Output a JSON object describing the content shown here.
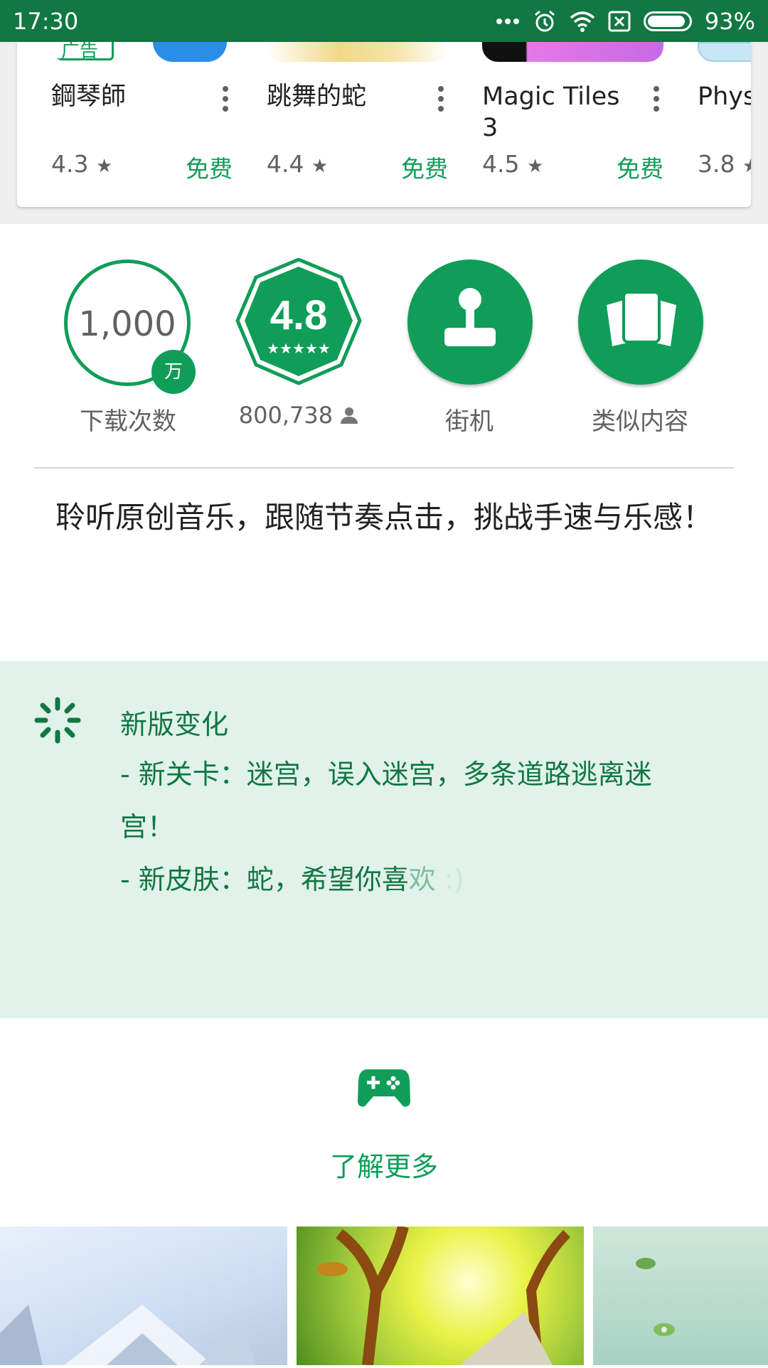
{
  "status_bar": {
    "time": "17:30",
    "battery": "93%",
    "icons": [
      "more-dots-icon",
      "alarm-icon",
      "wifi-icon",
      "no-sim-icon",
      "battery-icon"
    ]
  },
  "similar_apps": [
    {
      "name": "鋼琴師",
      "rating": "4.3",
      "price": "免费",
      "thumb_color": "#2a8ee8"
    },
    {
      "name": "跳舞的蛇",
      "rating": "4.4",
      "price": "免费",
      "thumb_color": "#f2d889"
    },
    {
      "name": "Magic Tiles 3",
      "rating": "4.5",
      "price": "免费",
      "thumb_color": "#d66de8"
    },
    {
      "name": "Phys Drop",
      "rating": "3.8",
      "price": "",
      "thumb_color": "#c7e6f5"
    }
  ],
  "ad_label": "广告",
  "stats": {
    "downloads_value": "1,000",
    "downloads_unit": "万",
    "downloads_label": "下载次数",
    "rating_value": "4.8",
    "rating_stars": 4.8,
    "reviewers": "800,738",
    "category_label": "街机",
    "similar_label": "类似内容"
  },
  "description": "聆听原创音乐，跟随节奏点击，挑战手速与乐感！",
  "whats_new": {
    "title": "新版变化",
    "line1": "- 新关卡：迷宫，误入迷宫，多条道路逃离迷宫！",
    "line2_main": "- 新皮肤：蛇，希望你喜",
    "line2_fade": "欢",
    "line2_fade2": " :)"
  },
  "learn_more": "了解更多",
  "colors": {
    "status_bar": "#117743",
    "accent": "#0f9d58",
    "whats_new_bg": "#e1f2ea"
  }
}
